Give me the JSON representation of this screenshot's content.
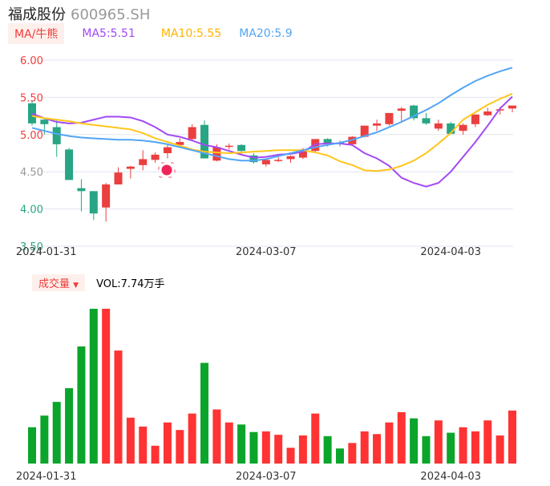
{
  "header": {
    "name": "福成股份",
    "code": "600965.SH"
  },
  "legend": {
    "tag": "MA/牛熊",
    "ma5": "MA5:5.51",
    "ma10": "MA10:5.55",
    "ma20": "MA20:5.9"
  },
  "volume_legend": {
    "tag": "成交量",
    "value": "VOL:7.74万手"
  },
  "colors": {
    "up": "#eb3f3f",
    "down": "#27a584",
    "ma5": "#a349f5",
    "ma10": "#ffc61a",
    "ma20": "#52a5f5",
    "grid": "#e3e6ef"
  },
  "chart_data": [
    {
      "type": "candlestick",
      "title": "福成股份 600965.SH",
      "ylim": [
        3.5,
        6.0
      ],
      "yticks": [
        "6.00",
        "5.50",
        "5.00",
        "4.50",
        "4.00",
        "3.50"
      ],
      "xticks": [
        {
          "index": 2,
          "label": "2024-01-31"
        },
        {
          "index": 19,
          "label": "2024-03-07"
        },
        {
          "index": 34,
          "label": "2024-04-03"
        }
      ],
      "ohlc": [
        [
          5.42,
          5.45,
          5.12,
          5.15
        ],
        [
          5.2,
          5.22,
          5.0,
          5.14
        ],
        [
          5.1,
          5.2,
          4.7,
          4.87
        ],
        [
          4.8,
          4.82,
          4.39,
          4.39
        ],
        [
          4.28,
          4.4,
          3.97,
          4.24
        ],
        [
          4.24,
          4.24,
          3.85,
          3.94
        ],
        [
          4.02,
          4.35,
          3.83,
          4.33
        ],
        [
          4.33,
          4.56,
          4.33,
          4.49
        ],
        [
          4.54,
          4.58,
          4.41,
          4.57
        ],
        [
          4.59,
          4.79,
          4.52,
          4.67
        ],
        [
          4.66,
          4.76,
          4.62,
          4.73
        ],
        [
          4.75,
          4.87,
          4.68,
          4.83
        ],
        [
          4.86,
          4.95,
          4.84,
          4.9
        ],
        [
          4.94,
          5.14,
          4.92,
          5.1
        ],
        [
          5.13,
          5.19,
          4.68,
          4.68
        ],
        [
          4.65,
          4.87,
          4.64,
          4.83
        ],
        [
          4.84,
          4.88,
          4.8,
          4.85
        ],
        [
          4.86,
          4.87,
          4.74,
          4.78
        ],
        [
          4.72,
          4.75,
          4.61,
          4.63
        ],
        [
          4.6,
          4.67,
          4.57,
          4.66
        ],
        [
          4.65,
          4.7,
          4.63,
          4.66
        ],
        [
          4.67,
          4.72,
          4.62,
          4.71
        ],
        [
          4.69,
          4.82,
          4.67,
          4.8
        ],
        [
          4.78,
          4.94,
          4.77,
          4.94
        ],
        [
          4.94,
          4.95,
          4.84,
          4.88
        ],
        [
          4.89,
          4.92,
          4.84,
          4.88
        ],
        [
          4.87,
          4.98,
          4.85,
          4.97
        ],
        [
          4.97,
          5.12,
          4.96,
          5.12
        ],
        [
          5.12,
          5.2,
          5.05,
          5.15
        ],
        [
          5.14,
          5.29,
          5.12,
          5.29
        ],
        [
          5.32,
          5.37,
          5.17,
          5.35
        ],
        [
          5.39,
          5.4,
          5.19,
          5.22
        ],
        [
          5.22,
          5.29,
          5.13,
          5.15
        ],
        [
          5.08,
          5.2,
          5.05,
          5.15
        ],
        [
          5.15,
          5.17,
          5.0,
          5.01
        ],
        [
          5.05,
          5.15,
          5.0,
          5.13
        ],
        [
          5.14,
          5.27,
          5.1,
          5.27
        ],
        [
          5.26,
          5.36,
          5.25,
          5.31
        ],
        [
          5.33,
          5.37,
          5.27,
          5.34
        ],
        [
          5.35,
          5.39,
          5.3,
          5.39
        ]
      ],
      "series": [
        {
          "name": "MA5",
          "values": [
            5.28,
            5.22,
            5.17,
            5.15,
            5.16,
            5.2,
            5.24,
            5.24,
            5.23,
            5.18,
            5.1,
            5.0,
            4.97,
            4.92,
            4.86,
            4.83,
            4.78,
            4.73,
            4.69,
            4.7,
            4.73,
            4.74,
            4.77,
            4.87,
            4.88,
            4.88,
            4.86,
            4.75,
            4.68,
            4.58,
            4.42,
            4.35,
            4.3,
            4.35,
            4.5,
            4.7,
            4.9,
            5.12,
            5.35,
            5.51
          ]
        },
        {
          "name": "MA10",
          "values": [
            5.25,
            5.22,
            5.2,
            5.18,
            5.15,
            5.13,
            5.11,
            5.09,
            5.07,
            5.02,
            4.95,
            4.9,
            4.85,
            4.8,
            4.77,
            4.76,
            4.75,
            4.76,
            4.77,
            4.78,
            4.79,
            4.79,
            4.79,
            4.76,
            4.72,
            4.64,
            4.59,
            4.52,
            4.51,
            4.53,
            4.58,
            4.65,
            4.75,
            4.88,
            5.02,
            5.2,
            5.3,
            5.4,
            5.48,
            5.55
          ]
        },
        {
          "name": "MA20",
          "values": [
            5.09,
            5.05,
            5.01,
            4.98,
            4.96,
            4.95,
            4.94,
            4.93,
            4.93,
            4.92,
            4.9,
            4.87,
            4.83,
            4.79,
            4.75,
            4.71,
            4.67,
            4.65,
            4.65,
            4.67,
            4.71,
            4.75,
            4.79,
            4.83,
            4.86,
            4.89,
            4.93,
            4.98,
            5.03,
            5.1,
            5.17,
            5.25,
            5.33,
            5.42,
            5.53,
            5.63,
            5.72,
            5.79,
            5.85,
            5.9
          ]
        }
      ]
    },
    {
      "type": "bar",
      "title": "成交量",
      "unit": "万手",
      "values": [
        5.3,
        7.0,
        9.0,
        11.0,
        17.1,
        22.6,
        22.6,
        16.5,
        6.7,
        5.4,
        2.6,
        6.0,
        4.9,
        7.3,
        14.7,
        7.9,
        6.0,
        5.7,
        4.6,
        4.7,
        4.2,
        2.3,
        4.1,
        7.3,
        4.0,
        2.2,
        3.0,
        4.7,
        4.3,
        6.0,
        7.5,
        6.6,
        4.0,
        6.3,
        4.5,
        5.3,
        4.7,
        6.3,
        4.1,
        7.74
      ]
    }
  ]
}
